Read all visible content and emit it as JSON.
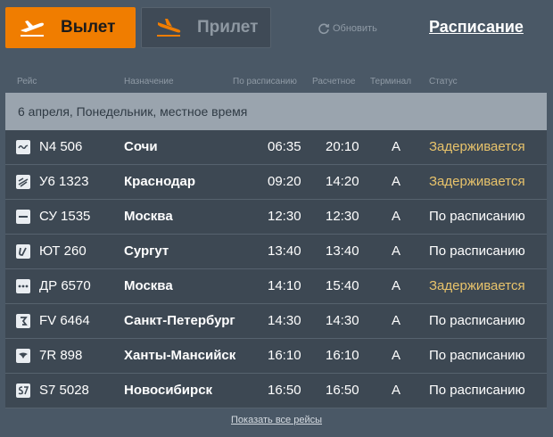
{
  "tabs": {
    "departure": {
      "label": "Вылет",
      "icon": "plane-takeoff-icon"
    },
    "arrival": {
      "label": "Прилет",
      "icon": "plane-landing-icon"
    }
  },
  "refresh_label": "Обновить",
  "schedule_link": "Расписание",
  "columns": {
    "flight": "Рейс",
    "destination": "Назначение",
    "scheduled": "По расписанию",
    "estimated": "Расчетное",
    "terminal": "Терминал",
    "status": "Статус"
  },
  "date_header": "6 апреля, Понедельник, местное время",
  "flights": [
    {
      "logo": "airline-logo-wave-icon",
      "flight": "N4 506",
      "destination": "Сочи",
      "scheduled": "06:35",
      "estimated": "20:10",
      "terminal": "A",
      "status": "Задерживается",
      "delayed": true
    },
    {
      "logo": "airline-logo-ural-icon",
      "flight": "У6 1323",
      "destination": "Краснодар",
      "scheduled": "09:20",
      "estimated": "14:20",
      "terminal": "A",
      "status": "Задерживается",
      "delayed": true
    },
    {
      "logo": "airline-logo-aeroflot-icon",
      "flight": "СУ 1535",
      "destination": "Москва",
      "scheduled": "12:30",
      "estimated": "12:30",
      "terminal": "A",
      "status": "По расписанию",
      "delayed": false
    },
    {
      "logo": "airline-logo-utair-icon",
      "flight": "ЮТ 260",
      "destination": "Сургут",
      "scheduled": "13:40",
      "estimated": "13:40",
      "terminal": "A",
      "status": "По расписанию",
      "delayed": false
    },
    {
      "logo": "airline-logo-dots-icon",
      "flight": "ДР 6570",
      "destination": "Москва",
      "scheduled": "14:10",
      "estimated": "15:40",
      "terminal": "A",
      "status": "Задерживается",
      "delayed": true
    },
    {
      "logo": "airline-logo-rossiya-icon",
      "flight": "FV 6464",
      "destination": "Санкт-Петербург",
      "scheduled": "14:30",
      "estimated": "14:30",
      "terminal": "A",
      "status": "По расписанию",
      "delayed": false
    },
    {
      "logo": "airline-logo-utair-bird-icon",
      "flight": "7R 898",
      "destination": "Ханты-Мансийск",
      "scheduled": "16:10",
      "estimated": "16:10",
      "terminal": "A",
      "status": "По расписанию",
      "delayed": false
    },
    {
      "logo": "airline-logo-s7-icon",
      "flight": "S7 5028",
      "destination": "Новосибирск",
      "scheduled": "16:50",
      "estimated": "16:50",
      "terminal": "A",
      "status": "По расписанию",
      "delayed": false
    }
  ],
  "show_all_link": "Показать все рейсы",
  "colors": {
    "accent": "#f07d00",
    "delayed": "#e8c36b",
    "background": "#4a5866"
  }
}
